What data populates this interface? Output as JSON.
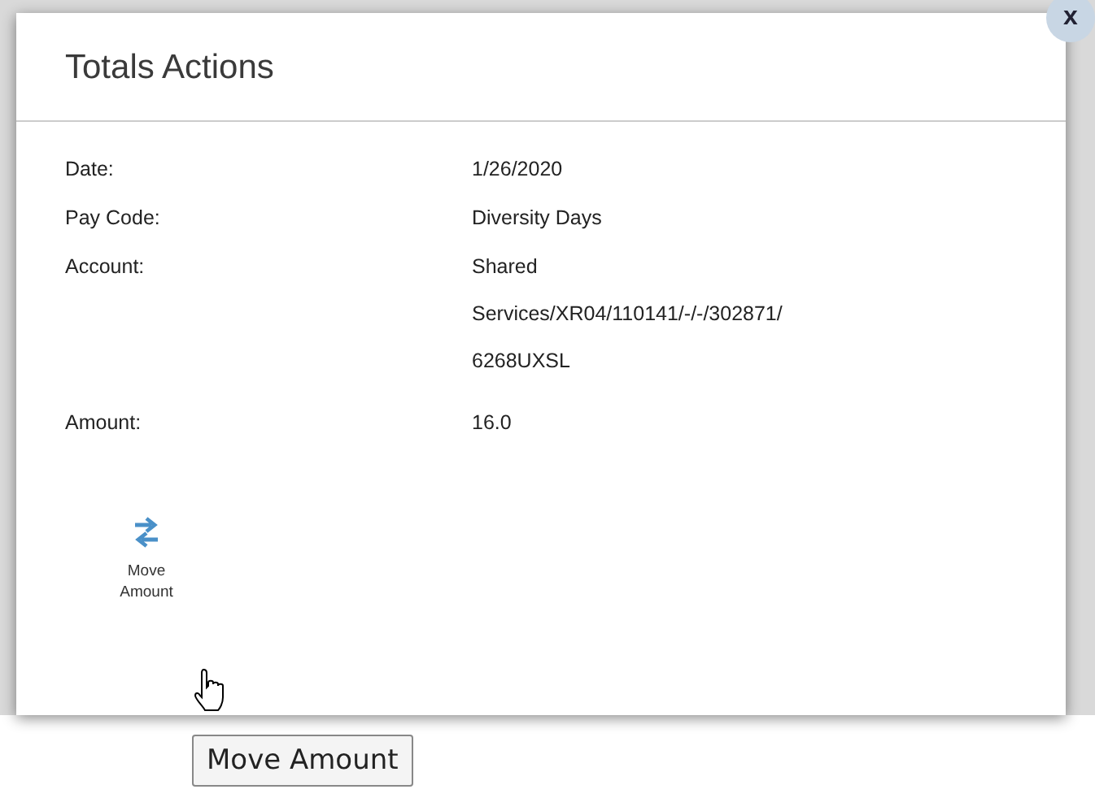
{
  "dialog": {
    "title": "Totals Actions",
    "fields": [
      {
        "label": "Date:",
        "value": "1/26/2020"
      },
      {
        "label": "Pay Code:",
        "value": "Diversity Days"
      },
      {
        "label": "Account:",
        "value": "Shared Services/XR04/110141/-/-/302871/ 6268UXSL"
      },
      {
        "label": "Amount:",
        "value": "16.0"
      }
    ],
    "actions": [
      {
        "label": "Move Amount"
      }
    ]
  },
  "close": "x",
  "tooltip": "Move Amount"
}
